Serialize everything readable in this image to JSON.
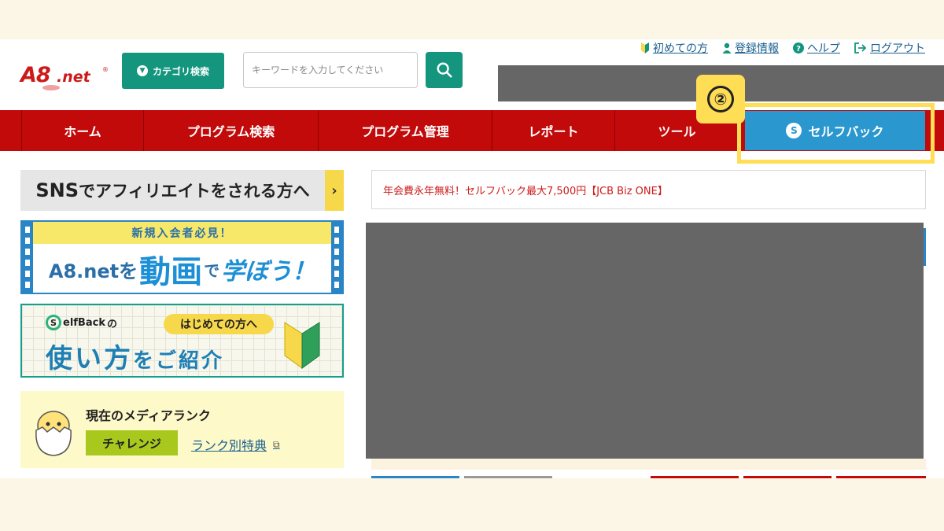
{
  "header": {
    "logo_main": "A8",
    "logo_suffix": ".net",
    "logo_reg": "®",
    "category_button": "カテゴリ検索",
    "search_placeholder": "キーワードを入力してください",
    "top_links": [
      {
        "label": "初めての方",
        "icon": "beginner-mark-icon"
      },
      {
        "label": "登録情報",
        "icon": "user-icon"
      },
      {
        "label": "ヘルプ",
        "icon": "help-icon"
      },
      {
        "label": "ログアウト",
        "icon": "logout-icon"
      }
    ]
  },
  "nav": {
    "items": [
      "ホーム",
      "プログラム検索",
      "プログラム管理",
      "レポート",
      "ツール"
    ],
    "selfback": "セルフバック",
    "step_marker": "②"
  },
  "left": {
    "sns_banner": {
      "prefix": "SNS",
      "text": "でアフィリエイトをされる方へ",
      "arrow": "›"
    },
    "video_banner": {
      "top": "新規入会者必見！",
      "part1": "A8.netを",
      "part2": "動画",
      "part3": "で",
      "part4": "学ぼう！"
    },
    "selfback_banner": {
      "logo": "elfBack",
      "logo_s": "S",
      "logo_no": "の",
      "pill": "はじめての方へ",
      "main1": "使い方",
      "main2": "をご紹介"
    },
    "rank": {
      "title": "現在のメディアランク",
      "badge": "チャレンジ",
      "link": "ランク別特典",
      "ext_icon": "⧉"
    }
  },
  "right": {
    "news": "年会費永年無料！セルフバック最大7,500円【JCB Biz ONE】"
  },
  "colors": {
    "brand_red": "#c20a0a",
    "teal": "#14957e",
    "selfback_blue": "#2a97cf",
    "highlight_yellow": "#ffdd55"
  }
}
